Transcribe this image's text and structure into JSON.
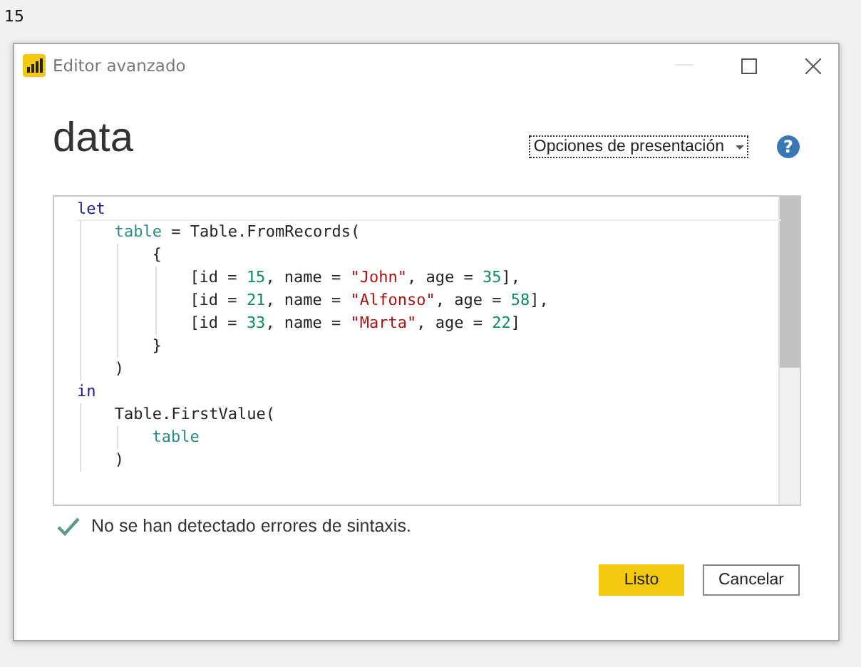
{
  "page_label": "15",
  "window": {
    "title": "Editor avanzado"
  },
  "query_name": "data",
  "display_options": {
    "label": "Opciones de presentación",
    "focused": true
  },
  "help": "?",
  "code_lines": [
    {
      "tokens": [
        {
          "kind": "keyword",
          "text": "let"
        }
      ],
      "children": [
        {
          "tokens": [
            {
              "kind": "ident",
              "text": "table"
            },
            {
              "kind": "plain",
              "text": " = Table.FromRecords("
            }
          ],
          "children": [
            {
              "tokens": [
                {
                  "kind": "plain",
                  "text": "{"
                }
              ],
              "children": [
                {
                  "tokens": [
                    {
                      "kind": "plain",
                      "text": "[id = "
                    },
                    {
                      "kind": "number",
                      "text": "15"
                    },
                    {
                      "kind": "plain",
                      "text": ", name = "
                    },
                    {
                      "kind": "string",
                      "text": "\"John\""
                    },
                    {
                      "kind": "plain",
                      "text": ", age = "
                    },
                    {
                      "kind": "number",
                      "text": "35"
                    },
                    {
                      "kind": "plain",
                      "text": "],"
                    }
                  ]
                },
                {
                  "tokens": [
                    {
                      "kind": "plain",
                      "text": "[id = "
                    },
                    {
                      "kind": "number",
                      "text": "21"
                    },
                    {
                      "kind": "plain",
                      "text": ", name = "
                    },
                    {
                      "kind": "string",
                      "text": "\"Alfonso\""
                    },
                    {
                      "kind": "plain",
                      "text": ", age = "
                    },
                    {
                      "kind": "number",
                      "text": "58"
                    },
                    {
                      "kind": "plain",
                      "text": "],"
                    }
                  ]
                },
                {
                  "tokens": [
                    {
                      "kind": "plain",
                      "text": "[id = "
                    },
                    {
                      "kind": "number",
                      "text": "33"
                    },
                    {
                      "kind": "plain",
                      "text": ", name = "
                    },
                    {
                      "kind": "string",
                      "text": "\"Marta\""
                    },
                    {
                      "kind": "plain",
                      "text": ", age = "
                    },
                    {
                      "kind": "number",
                      "text": "22"
                    },
                    {
                      "kind": "plain",
                      "text": "]"
                    }
                  ]
                }
              ]
            },
            {
              "tokens": [
                {
                  "kind": "plain",
                  "text": "}"
                }
              ]
            }
          ]
        },
        {
          "tokens": [
            {
              "kind": "plain",
              "text": ")"
            }
          ]
        }
      ]
    },
    {
      "tokens": [
        {
          "kind": "keyword",
          "text": "in"
        }
      ],
      "children": [
        {
          "tokens": [
            {
              "kind": "plain",
              "text": "Table.FirstValue("
            }
          ],
          "children": [
            {
              "tokens": [
                {
                  "kind": "ident",
                  "text": "table"
                }
              ]
            }
          ]
        },
        {
          "tokens": [
            {
              "kind": "plain",
              "text": ")"
            }
          ]
        }
      ]
    }
  ],
  "status": {
    "ok": true,
    "text": "No se han detectado errores de sintaxis."
  },
  "buttons": [
    {
      "label": "Listo",
      "primary": true
    },
    {
      "label": "Cancelar",
      "primary": false
    }
  ]
}
